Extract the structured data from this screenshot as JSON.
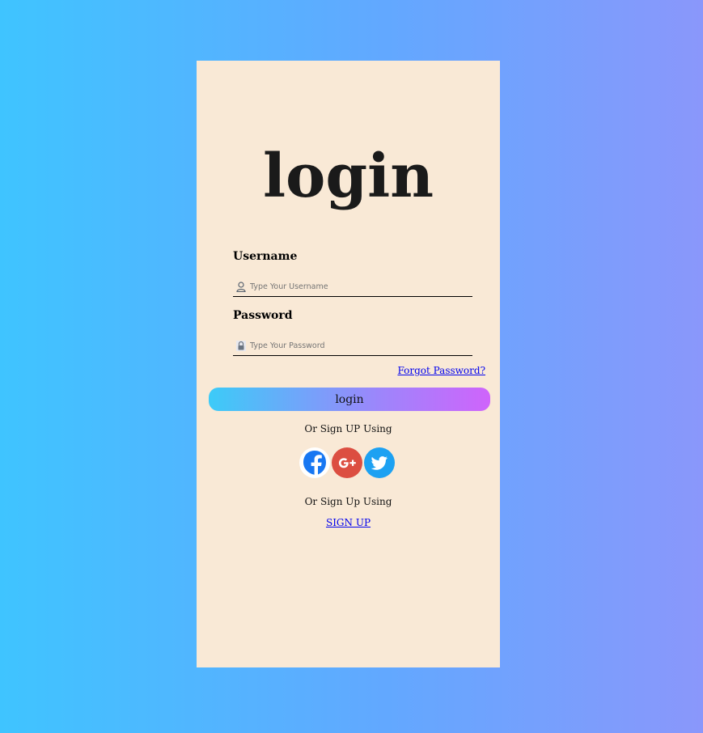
{
  "card": {
    "title": "login"
  },
  "form": {
    "username_label": "Username",
    "username_placeholder": "Type Your Username",
    "password_label": "Password",
    "password_placeholder": "Type Your Password",
    "forgot_link": "Forgot Password?",
    "login_button": "login"
  },
  "social": {
    "heading": "Or Sign UP Using",
    "icons": [
      "facebook-icon",
      "google-plus-icon",
      "twitter-icon"
    ]
  },
  "signup": {
    "heading": "Or Sign Up Using",
    "link": "SIGN UP"
  },
  "colors": {
    "card_bg": "#f9e9d6",
    "button_gradient_start": "#3ccbf8",
    "button_gradient_end": "#cf64fb",
    "facebook": "#1877f2",
    "google": "#dc4e41",
    "twitter": "#1da1f2",
    "link": "#0000ee"
  }
}
